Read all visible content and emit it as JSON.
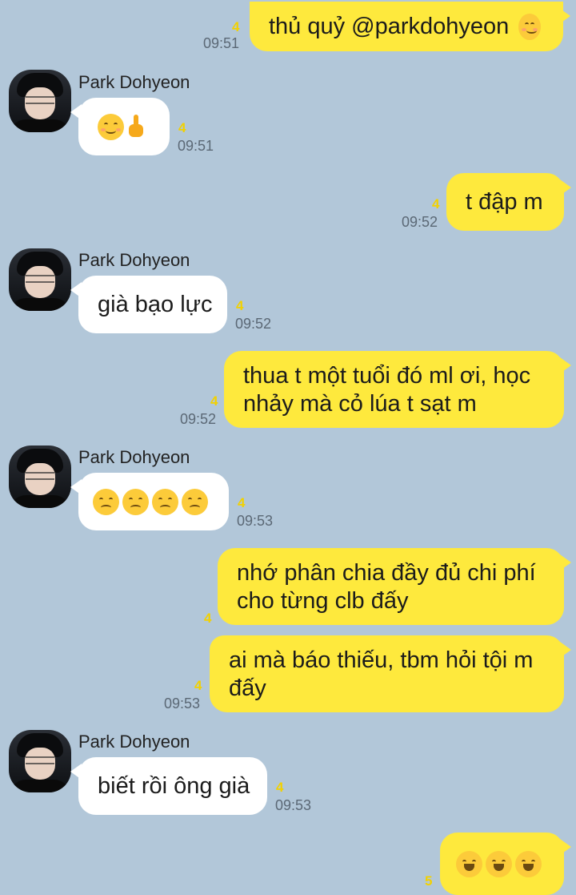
{
  "messages": [
    {
      "side": "mine",
      "text": "thủ quỷ @parkdohyeon",
      "emoji": "smiling-blush",
      "unread": "4",
      "time": "09:51"
    },
    {
      "side": "theirs",
      "sender": "Park Dohyeon",
      "emojis": [
        "smiling-blush",
        "middle-finger"
      ],
      "unread": "4",
      "time": "09:51"
    },
    {
      "side": "mine",
      "text": "t đập m",
      "unread": "4",
      "time": "09:52"
    },
    {
      "side": "theirs",
      "sender": "Park Dohyeon",
      "text": "già bạo lực",
      "unread": "4",
      "time": "09:52"
    },
    {
      "side": "mine",
      "lines": [
        "thua t một tuổi đó ml ơi, học",
        "nhảy mà cỏ lúa t sạt m"
      ],
      "unread": "4",
      "time": "09:52"
    },
    {
      "side": "theirs",
      "sender": "Park Dohyeon",
      "emojis": [
        "disappointed",
        "disappointed",
        "disappointed",
        "disappointed"
      ],
      "unread": "4",
      "time": "09:53"
    },
    {
      "side": "mine",
      "lines": [
        "nhớ phân chia đầy đủ chi phí",
        "cho từng clb đấy"
      ],
      "unread": "4"
    },
    {
      "side": "mine",
      "lines": [
        "ai mà báo thiếu, tbm hỏi tội m",
        "đấy"
      ],
      "unread": "4",
      "time": "09:53"
    },
    {
      "side": "theirs",
      "sender": "Park Dohyeon",
      "text": "biết rồi ông già",
      "unread": "4",
      "time": "09:53"
    },
    {
      "side": "mine",
      "emojis": [
        "grinning",
        "grinning",
        "grinning"
      ],
      "unread": "5"
    }
  ],
  "colors": {
    "background": "#b2c7d9",
    "my_bubble": "#fee93d",
    "their_bubble": "#ffffff",
    "unread_count": "#f2d100"
  }
}
